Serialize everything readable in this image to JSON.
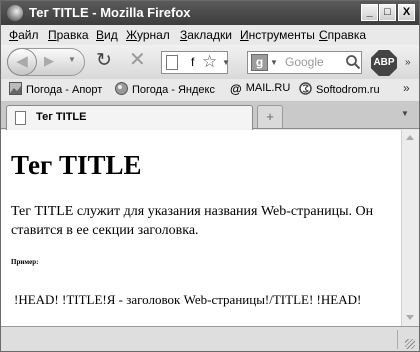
{
  "window": {
    "title": "Тег TITLE - Mozilla Firefox",
    "controls": {
      "minimize": "_",
      "maximize": "□",
      "close": "X"
    }
  },
  "menu": [
    "Файл",
    "Правка",
    "Вид",
    "Журнал",
    "Закладки",
    "Инструменты",
    "Справка"
  ],
  "nav": {
    "url_text": "f",
    "search_engine_letter": "g",
    "search_placeholder": "Google",
    "adblock_label": "ABP",
    "more": "»"
  },
  "bookmarks": {
    "items": [
      "Погода - Апорт",
      "Погода - Яндекс",
      "MAIL.RU",
      "Softodrom.ru"
    ],
    "more": "»"
  },
  "tabs": {
    "active_title": "Тег TITLE",
    "new_tab": "+"
  },
  "page": {
    "heading": "Тег TITLE",
    "paragraph": "Тег TITLE служит для указания названия Web-страницы. Он ставится в ее секции заголовка.",
    "example_label": "Пример:",
    "code_line": "!HEAD! !TITLE!Я - заголовок Web-страницы!/TITLE! !HEAD!"
  },
  "status": {
    "text": ""
  },
  "colors": {
    "titlebar": "#4a4a4a",
    "toolbar": "#e7e7e7",
    "content": "#ffffff"
  }
}
